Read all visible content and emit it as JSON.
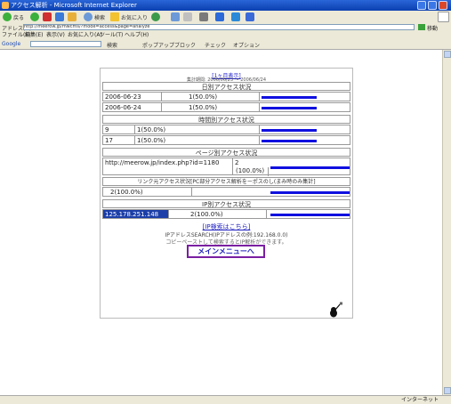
{
  "window": {
    "title": "アクセス解析 - Microsoft Internet Explorer"
  },
  "toolbar": {
    "back": "戻る",
    "search": "検索",
    "favorites": "お気に入り"
  },
  "address": {
    "label": "アドレス(D)",
    "url": "http://meerow.jp/mwcms/?mode=access&page=analyze",
    "go": "移動"
  },
  "links_bar": [
    "ファイル(F)",
    "編集(E)",
    "表示(V)",
    "お気に入り(A)",
    "ツール(T)",
    "ヘルプ(H)"
  ],
  "google_bar": {
    "logo": "Google",
    "search_label": "検索",
    "items": [
      "ポップアップブロック",
      "チェック",
      "オプション"
    ]
  },
  "page": {
    "header_link": "[1ヶ月表示]",
    "period": "集計期間: 2006/06/23 〜 2006/06/24",
    "sections": {
      "daily": "日別アクセス状況",
      "hourly": "時間別アクセス状況",
      "page": "ページ別アクセス状況",
      "link": "リンク元アクセス状況[PC部分アクセス解析をーポスのし(まみ時のみ集計]",
      "ip": "IP別アクセス状況"
    },
    "daily_rows": [
      {
        "date": "2006-06-23",
        "count": "1(50.0%)",
        "ratio": 0.5
      },
      {
        "date": "2006-06-24",
        "count": "1(50.0%)",
        "ratio": 0.5
      }
    ],
    "hourly_rows": [
      {
        "hour": "9",
        "count": "1(50.0%)",
        "ratio": 0.5
      },
      {
        "hour": "17",
        "count": "1(50.0%)",
        "ratio": 0.5
      }
    ],
    "page_rows": [
      {
        "url": "http://meerow.jp/index.php?id=1180",
        "count": "2",
        "percent": "(100.0%)",
        "ratio": 1.0
      }
    ],
    "link_rows": [
      {
        "count": "2(100.0%)",
        "ratio": 1.0
      }
    ],
    "ip_rows": [
      {
        "ip": "125.178.251.148",
        "count": "2(100.0%)",
        "ratio": 1.0
      }
    ],
    "ip_link": "[IP検索はこちら]",
    "ip_note1": "IPアドレスSEARCH(IPアドレスの例:192.168.0.0)",
    "ip_note2": "コピーペーストして検索するとIP解析ができます。",
    "menu_button": "メインメニューへ"
  },
  "status": {
    "left": "",
    "right": "インターネット"
  },
  "colors": {
    "bar": "#1010e0",
    "titlebar": "#0a3fb0",
    "menu_border": "#7a1fa2"
  }
}
